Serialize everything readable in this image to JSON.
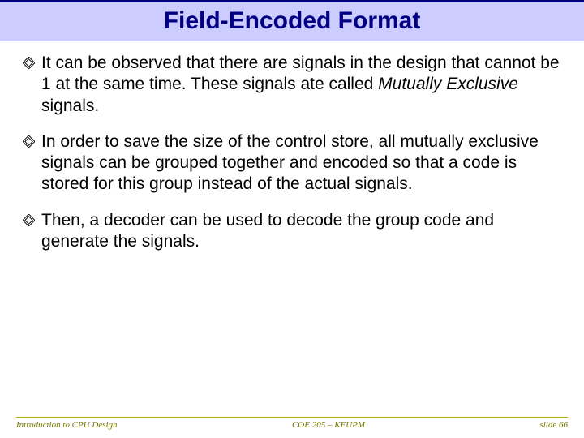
{
  "title": "Field-Encoded Format",
  "bullets": [
    {
      "pre": "It can be observed that there are signals in the design that cannot be 1 at the same time. These signals ate called ",
      "em": "Mutually Exclusive",
      "post": " signals."
    },
    {
      "pre": "In order to save the size of the control store, all mutually exclusive signals can be grouped together and encoded so that a code is stored for this group instead of the actual signals.",
      "em": "",
      "post": ""
    },
    {
      "pre": "Then, a decoder can be used to decode the group code and generate the signals.",
      "em": "",
      "post": ""
    }
  ],
  "footer": {
    "left": "Introduction to CPU Design",
    "center": "COE 205 – KFUPM",
    "right": "slide 66"
  }
}
